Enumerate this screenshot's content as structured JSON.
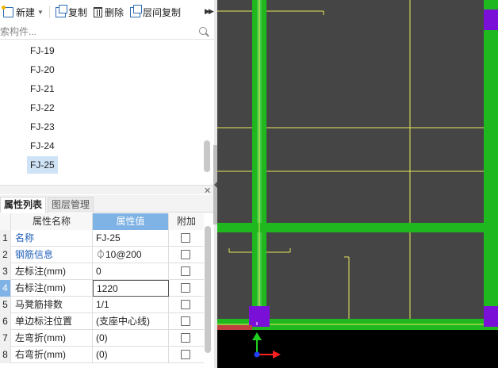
{
  "toolbar": {
    "new_label": "新建",
    "copy_label": "复制",
    "delete_label": "删除",
    "floor_copy_label": "层间复制"
  },
  "search": {
    "placeholder": "搜索构件..."
  },
  "tree": {
    "items": [
      "FJ-19",
      "FJ-20",
      "FJ-21",
      "FJ-22",
      "FJ-23",
      "FJ-24",
      "FJ-25"
    ],
    "selected": "FJ-25"
  },
  "tabs": {
    "properties": "属性列表",
    "layers": "图层管理"
  },
  "grid": {
    "headers": {
      "name": "属性名称",
      "value": "属性值",
      "extra": "附加"
    },
    "rows": [
      {
        "num": "1",
        "name": "名称",
        "value": "FJ-25"
      },
      {
        "num": "2",
        "name": "钢筋信息",
        "value": "⏀10@200"
      },
      {
        "num": "3",
        "name": "左标注(mm)",
        "value": "0"
      },
      {
        "num": "4",
        "name": "右标注(mm)",
        "value": "1220"
      },
      {
        "num": "5",
        "name": "马凳筋排数",
        "value": "1/1"
      },
      {
        "num": "6",
        "name": "单边标注位置",
        "value": "(支座中心线)"
      },
      {
        "num": "7",
        "name": "左弯折(mm)",
        "value": "(0)"
      },
      {
        "num": "8",
        "name": "右弯折(mm)",
        "value": "(0)"
      }
    ]
  },
  "canvas": {
    "axis_x_label": "X",
    "colors": {
      "background": "#454545",
      "beam": "#1fb81f",
      "line": "#e8e85a",
      "column": "#7a10d8",
      "axis_x": "#ff2020",
      "axis_y": "#20d020"
    }
  }
}
